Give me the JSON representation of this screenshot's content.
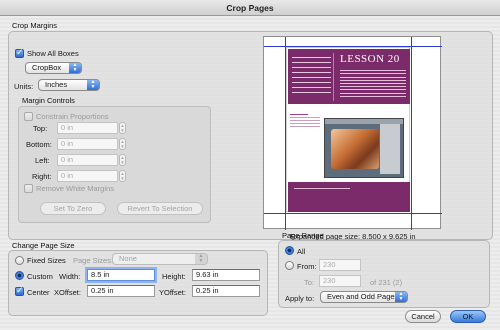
{
  "window": {
    "title": "Crop Pages"
  },
  "crop_margins": {
    "title": "Crop Margins",
    "show_all_boxes_label": "Show All Boxes",
    "show_all_boxes_checked": true,
    "box_select": "CropBox",
    "units_label": "Units:",
    "units_select": "Inches",
    "margin_controls": {
      "title": "Margin Controls",
      "constrain_label": "Constrain Proportions",
      "top_label": "Top:",
      "top_value": "0 in",
      "bottom_label": "Bottom:",
      "bottom_value": "0 in",
      "left_label": "Left:",
      "left_value": "0 in",
      "right_label": "Right:",
      "right_value": "0 in",
      "remove_white_label": "Remove White Margins",
      "set_zero_label": "Set To Zero",
      "revert_label": "Revert To Selection"
    }
  },
  "preview": {
    "thumb_title": "LESSON 20",
    "expanded_size": "Expanded page size: 8.500 x 9.625 in"
  },
  "change_page_size": {
    "title": "Change Page Size",
    "fixed_sizes_label": "Fixed Sizes",
    "page_sizes_label": "Page Sizes:",
    "page_sizes_value": "None",
    "custom_label": "Custom",
    "width_label": "Width:",
    "width_value": "8.5 in",
    "height_label": "Height:",
    "height_value": "9.63 in",
    "center_label": "Center",
    "xoffset_label": "XOffset:",
    "xoffset_value": "0.25 in",
    "yoffset_label": "YOffset:",
    "yoffset_value": "0.25 in",
    "selected_mode": "custom",
    "center_checked": true
  },
  "page_range": {
    "title": "Page Range",
    "all_label": "All",
    "from_label": "From:",
    "from_value": "230",
    "to_label": "To:",
    "to_value": "230",
    "of_label": "of 231 (2)",
    "apply_label": "Apply to:",
    "apply_value": "Even and Odd Pages",
    "selected": "all"
  },
  "buttons": {
    "cancel": "Cancel",
    "ok": "OK"
  },
  "colors": {
    "accent": "#3879dc",
    "thumb_brand": "#7b2a6a",
    "crop_line": "#2f3bd6"
  }
}
